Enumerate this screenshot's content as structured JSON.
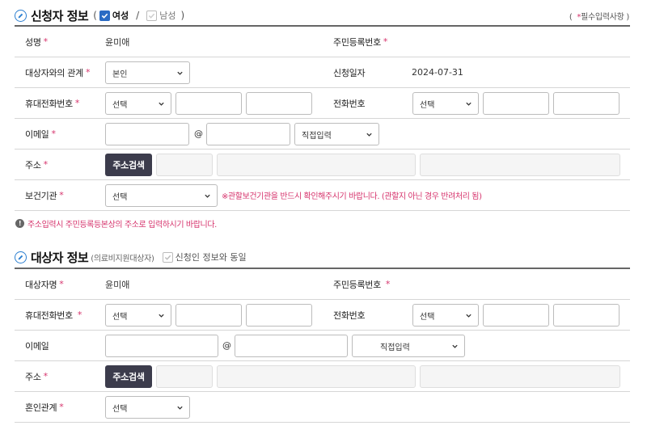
{
  "applicant": {
    "title": "신청자 정보",
    "gender_female": "여성",
    "gender_male": "남성",
    "required_legend": "필수입력사항",
    "name_label": "성명",
    "name_value": "윤미애",
    "rrn_label": "주민등록번호",
    "relation_label": "대상자와의 관계",
    "relation_value": "본인",
    "date_label": "신청일자",
    "date_value": "2024-07-31",
    "mobile_label": "휴대전화번호",
    "mobile_select": "선택",
    "phone_label": "전화번호",
    "phone_select": "선택",
    "email_label": "이메일",
    "email_at": "@",
    "email_domain_select": "직접입력",
    "address_label": "주소",
    "address_button": "주소검색",
    "health_label": "보건기관",
    "health_select": "선택",
    "health_warning": "※관할보건기관을 반드시 확인해주시기 바랍니다. (관할지 아닌 경우 반려처리 됨)",
    "notice": "주소입력시 주민등록등본상의 주소로 입력하시기 바랍니다."
  },
  "target": {
    "title": "대상자 정보",
    "subtitle": "(의료비지원대상자)",
    "same_as_applicant": "신청인 정보와 동일",
    "name_label": "대상자명",
    "name_value": "윤미애",
    "rrn_label": "주민등록번호",
    "mobile_label": "휴대전화번호",
    "mobile_select": "선택",
    "phone_label": "전화번호",
    "phone_select": "선택",
    "email_label": "이메일",
    "email_at": "@",
    "email_domain_select": "직접입력",
    "address_label": "주소",
    "address_button": "주소검색",
    "marital_label": "혼인관계",
    "marital_select": "선택"
  },
  "symbols": {
    "required_mark": "*",
    "paren_open": "(",
    "paren_close": ")"
  },
  "colors": {
    "accent": "#2c7fd0",
    "required": "#d6336c",
    "button": "#3c3c4c"
  }
}
